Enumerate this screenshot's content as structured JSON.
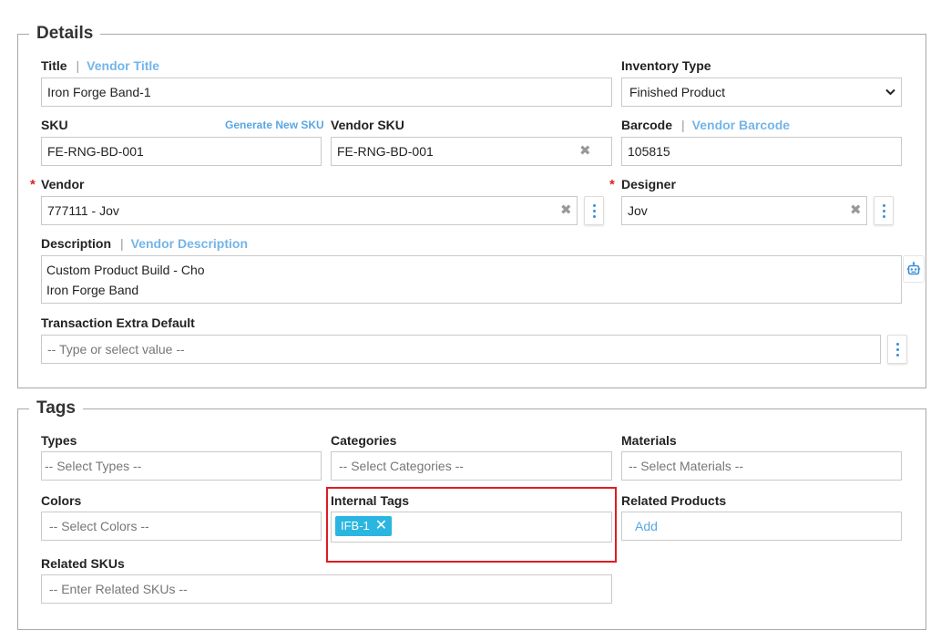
{
  "details": {
    "legend": "Details",
    "title_label": "Title",
    "vendor_title_link": "Vendor Title",
    "title_value": "Iron Forge Band-1",
    "inventory_type_label": "Inventory Type",
    "inventory_type_value": "Finished Product",
    "sku_label": "SKU",
    "generate_sku_link": "Generate New SKU",
    "sku_value": "FE-RNG-BD-001",
    "vendor_sku_label": "Vendor SKU",
    "vendor_sku_value": "FE-RNG-BD-001",
    "barcode_label": "Barcode",
    "vendor_barcode_link": "Vendor Barcode",
    "barcode_value": "105815",
    "required_mark": "*",
    "vendor_label": "Vendor",
    "vendor_value": "777111 - Jov",
    "designer_label": "Designer",
    "designer_value": "Jov",
    "description_label": "Description",
    "vendor_description_link": "Vendor Description",
    "description_line1": "Custom Product Build - Cho",
    "description_line2": "Iron Forge Band",
    "transaction_extra_label": "Transaction Extra Default",
    "transaction_extra_placeholder": "-- Type or select value --",
    "separator": "|"
  },
  "tags": {
    "legend": "Tags",
    "types_label": "Types",
    "types_placeholder": "-- Select Types --",
    "categories_label": "Categories",
    "categories_placeholder": "-- Select Categories --",
    "materials_label": "Materials",
    "materials_placeholder": "-- Select Materials --",
    "colors_label": "Colors",
    "colors_placeholder": "-- Select Colors --",
    "internal_tags_label": "Internal Tags",
    "internal_tags": [
      {
        "label": "IFB-1"
      }
    ],
    "related_products_label": "Related Products",
    "related_products_add": "Add",
    "related_skus_label": "Related SKUs",
    "related_skus_placeholder": "-- Enter Related SKUs --"
  },
  "icons": {
    "clear": "clear-x-icon",
    "more": "kebab-menu-icon",
    "ai": "robot-icon",
    "caret": "chevron-down-icon"
  },
  "colors": {
    "accent_link": "#74b5e8",
    "tag_chip": "#2ab6e0",
    "highlight": "#e01b22",
    "required": "#dd2222"
  }
}
